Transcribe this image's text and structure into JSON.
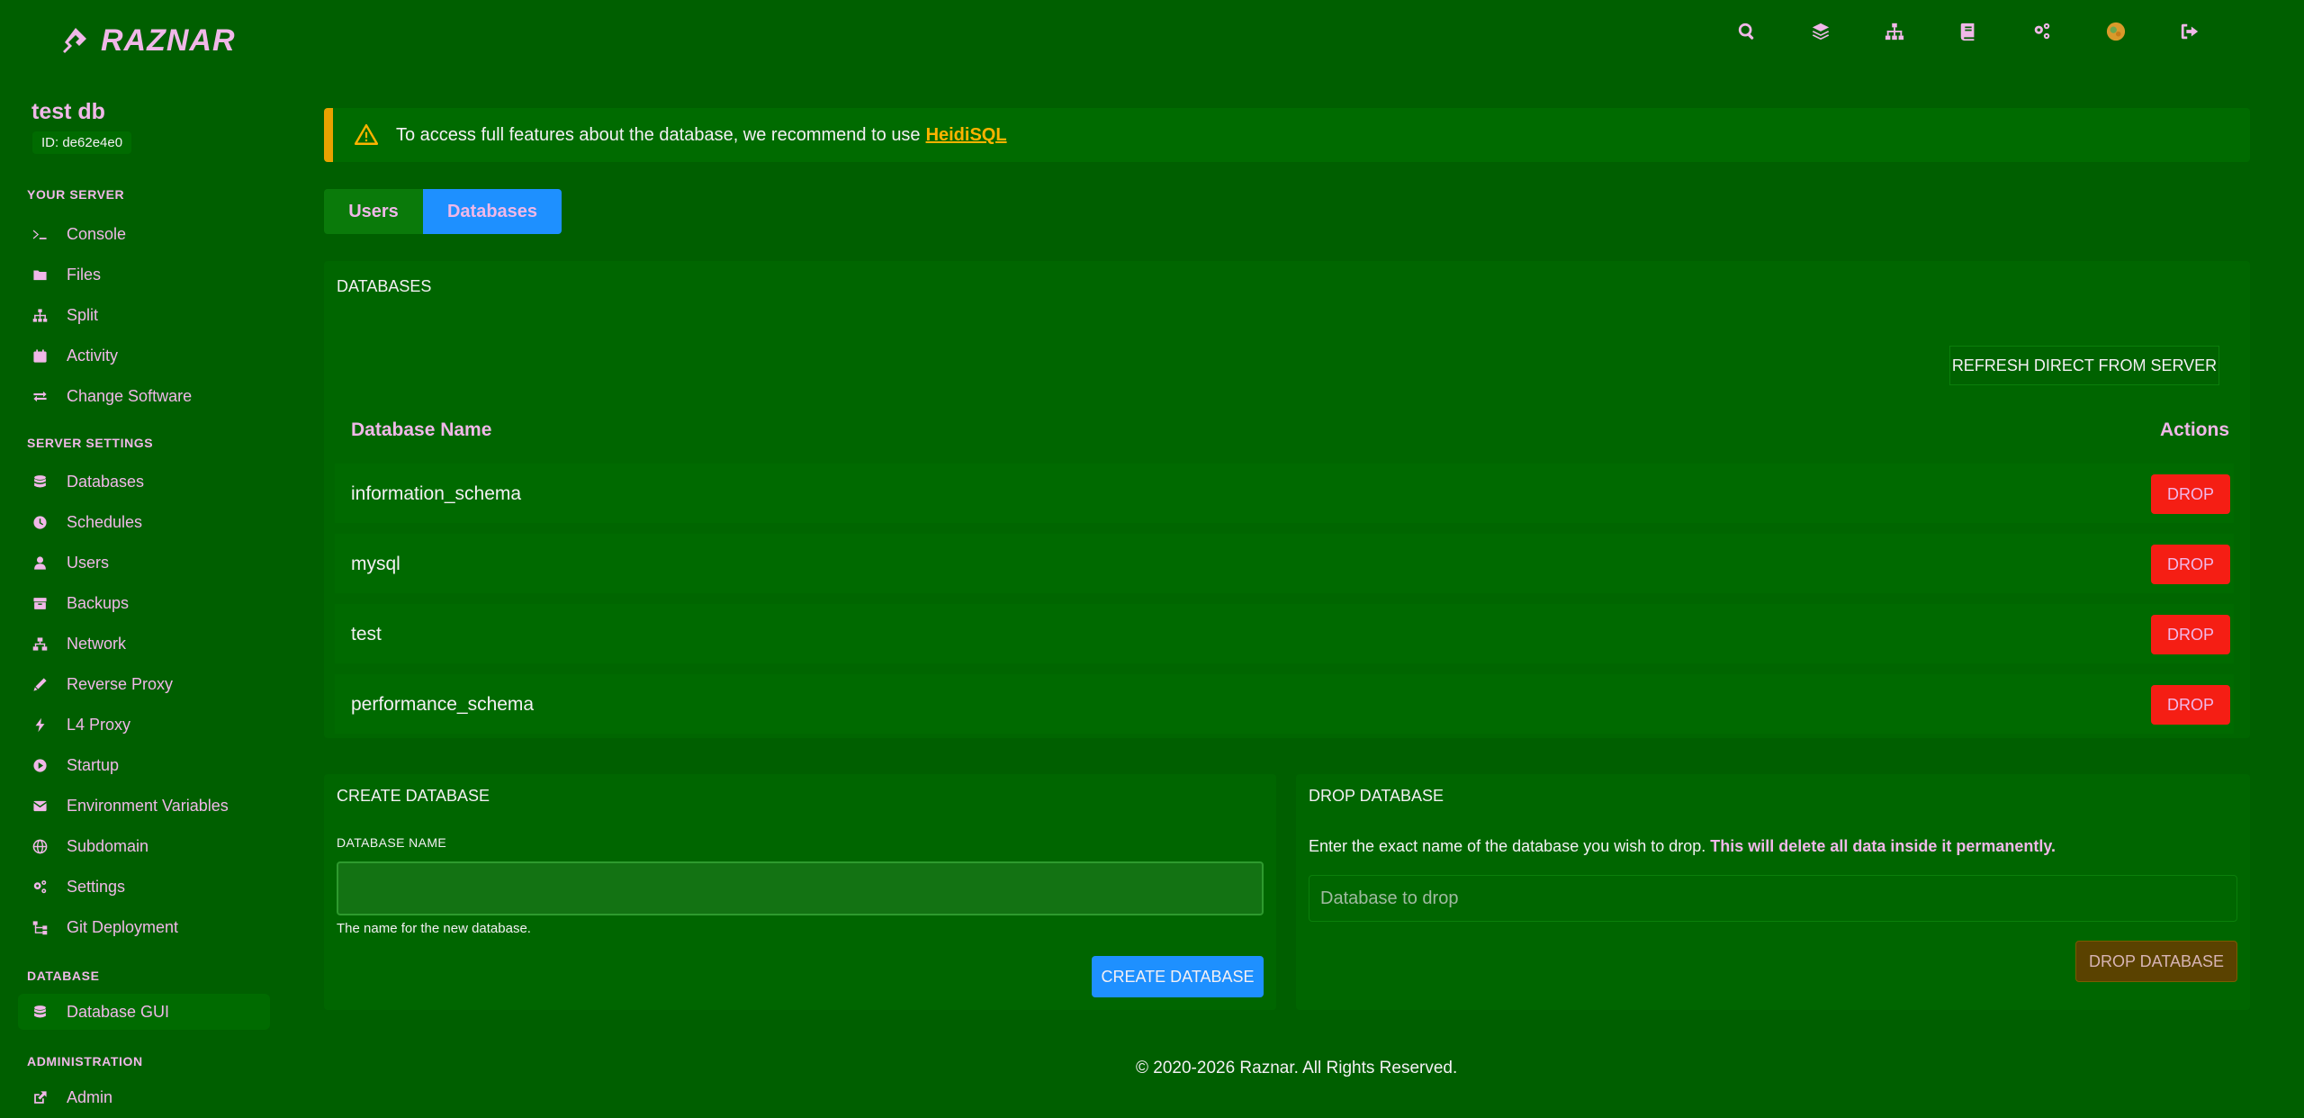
{
  "brand": {
    "name": "RAZNAR"
  },
  "topbar": {
    "icons": [
      "search-icon",
      "layers-icon",
      "sitemap-icon",
      "book-icon",
      "users-cog-icon",
      "avatar",
      "logout-icon"
    ]
  },
  "server": {
    "name": "test db",
    "id": "ID: de62e4e0"
  },
  "sidebar": {
    "sections": {
      "your_server": "YOUR SERVER",
      "server_settings": "SERVER SETTINGS",
      "database": "DATABASE",
      "administration": "ADMINISTRATION"
    },
    "items": [
      {
        "label": "Console",
        "icon": "terminal-icon"
      },
      {
        "label": "Files",
        "icon": "folder-icon"
      },
      {
        "label": "Split",
        "icon": "sitemap-icon"
      },
      {
        "label": "Activity",
        "icon": "calendar-icon"
      },
      {
        "label": "Change Software",
        "icon": "exchange-icon"
      },
      {
        "label": "Databases",
        "icon": "database-icon"
      },
      {
        "label": "Schedules",
        "icon": "clock-icon"
      },
      {
        "label": "Users",
        "icon": "user-icon"
      },
      {
        "label": "Backups",
        "icon": "archive-icon"
      },
      {
        "label": "Network",
        "icon": "network-icon"
      },
      {
        "label": "Reverse Proxy",
        "icon": "pen-icon"
      },
      {
        "label": "L4 Proxy",
        "icon": "bolt-icon"
      },
      {
        "label": "Startup",
        "icon": "play-circle-icon"
      },
      {
        "label": "Environment Variables",
        "icon": "envelope-icon"
      },
      {
        "label": "Subdomain",
        "icon": "globe-icon"
      },
      {
        "label": "Settings",
        "icon": "cogs-icon"
      },
      {
        "label": "Git Deployment",
        "icon": "git-icon"
      },
      {
        "label": "Database GUI",
        "icon": "database-icon"
      },
      {
        "label": "Admin",
        "icon": "external-link-icon"
      }
    ]
  },
  "alert": {
    "text": "To access full features about the database, we recommend to use",
    "link": "HeidiSQL"
  },
  "tabs": {
    "users": "Users",
    "databases": "Databases"
  },
  "databases_panel": {
    "title": "DATABASES",
    "refresh": "REFRESH DIRECT FROM SERVER",
    "col_name": "Database Name",
    "col_actions": "Actions",
    "drop_label": "DROP",
    "rows": [
      "information_schema",
      "mysql",
      "test",
      "performance_schema"
    ]
  },
  "create_panel": {
    "title": "CREATE DATABASE",
    "field_label": "DATABASE NAME",
    "value": "",
    "help": "The name for the new database.",
    "button": "CREATE DATABASE"
  },
  "drop_panel": {
    "title": "DROP DATABASE",
    "desc": "Enter the exact name of the database you wish to drop.",
    "warning": "This will delete all data inside it permanently.",
    "placeholder": "Database to drop",
    "button": "DROP DATABASE"
  },
  "footer": {
    "text": "© 2020-2026 Raznar.  All Rights Reserved."
  },
  "colors": {
    "background": "#005f00",
    "accent": "#1e90ff",
    "danger": "#f51e14",
    "warning": "#e8a200",
    "text": "#f0b8e8"
  }
}
